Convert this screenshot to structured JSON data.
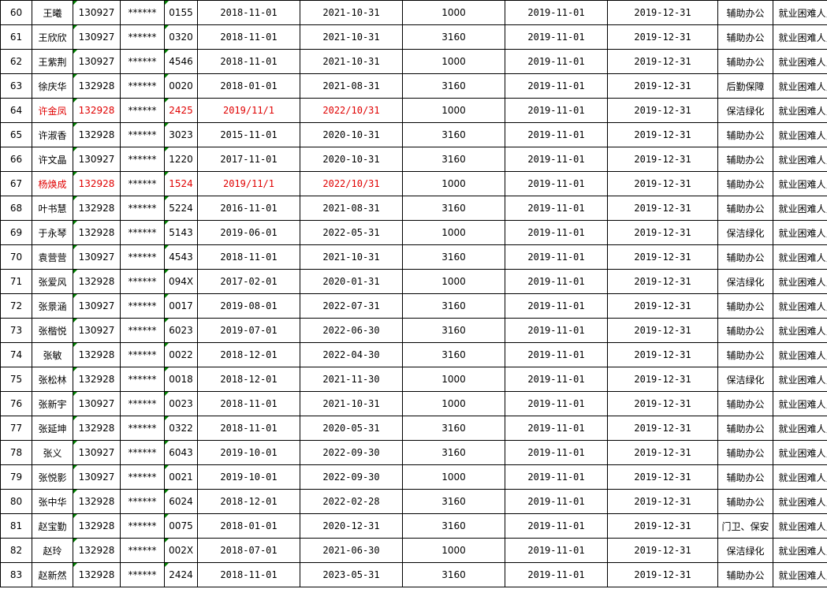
{
  "sheet": {
    "rows": [
      {
        "no": "60",
        "name": "王曦",
        "id_prefix": "130927",
        "mask": "******",
        "id_suffix": "0155",
        "start": "2018-11-01",
        "end": "2021-10-31",
        "amount": "1000",
        "period_start": "2019-11-01",
        "period_end": "2019-12-31",
        "post": "辅助办公",
        "category": "就业困难人员",
        "highlight": false
      },
      {
        "no": "61",
        "name": "王欣欣",
        "id_prefix": "130927",
        "mask": "******",
        "id_suffix": "0320",
        "start": "2018-11-01",
        "end": "2021-10-31",
        "amount": "3160",
        "period_start": "2019-11-01",
        "period_end": "2019-12-31",
        "post": "辅助办公",
        "category": "就业困难人员",
        "highlight": false
      },
      {
        "no": "62",
        "name": "王紫荆",
        "id_prefix": "130927",
        "mask": "******",
        "id_suffix": "4546",
        "start": "2018-11-01",
        "end": "2021-10-31",
        "amount": "1000",
        "period_start": "2019-11-01",
        "period_end": "2019-12-31",
        "post": "辅助办公",
        "category": "就业困难人员",
        "highlight": false
      },
      {
        "no": "63",
        "name": "徐庆华",
        "id_prefix": "132928",
        "mask": "******",
        "id_suffix": "0020",
        "start": "2018-01-01",
        "end": "2021-08-31",
        "amount": "3160",
        "period_start": "2019-11-01",
        "period_end": "2019-12-31",
        "post": "后勤保障",
        "category": "就业困难人员",
        "highlight": false
      },
      {
        "no": "64",
        "name": "许金凤",
        "id_prefix": "132928",
        "mask": "******",
        "id_suffix": "2425",
        "start": "2019/11/1",
        "end": "2022/10/31",
        "amount": "1000",
        "period_start": "2019-11-01",
        "period_end": "2019-12-31",
        "post": "保洁绿化",
        "category": "就业困难人员",
        "highlight": true
      },
      {
        "no": "65",
        "name": "许淑香",
        "id_prefix": "132928",
        "mask": "******",
        "id_suffix": "3023",
        "start": "2015-11-01",
        "end": "2020-10-31",
        "amount": "3160",
        "period_start": "2019-11-01",
        "period_end": "2019-12-31",
        "post": "辅助办公",
        "category": "就业困难人员",
        "highlight": false
      },
      {
        "no": "66",
        "name": "许文晶",
        "id_prefix": "130927",
        "mask": "******",
        "id_suffix": "1220",
        "start": "2017-11-01",
        "end": "2020-10-31",
        "amount": "3160",
        "period_start": "2019-11-01",
        "period_end": "2019-12-31",
        "post": "辅助办公",
        "category": "就业困难人员",
        "highlight": false
      },
      {
        "no": "67",
        "name": "杨焕成",
        "id_prefix": "132928",
        "mask": "******",
        "id_suffix": "1524",
        "start": "2019/11/1",
        "end": "2022/10/31",
        "amount": "1000",
        "period_start": "2019-11-01",
        "period_end": "2019-12-31",
        "post": "辅助办公",
        "category": "就业困难人员",
        "highlight": true
      },
      {
        "no": "68",
        "name": "叶书慧",
        "id_prefix": "132928",
        "mask": "******",
        "id_suffix": "5224",
        "start": "2016-11-01",
        "end": "2021-08-31",
        "amount": "3160",
        "period_start": "2019-11-01",
        "period_end": "2019-12-31",
        "post": "辅助办公",
        "category": "就业困难人员",
        "highlight": false
      },
      {
        "no": "69",
        "name": "于永琴",
        "id_prefix": "132928",
        "mask": "******",
        "id_suffix": "5143",
        "start": "2019-06-01",
        "end": "2022-05-31",
        "amount": "1000",
        "period_start": "2019-11-01",
        "period_end": "2019-12-31",
        "post": "保洁绿化",
        "category": "就业困难人员",
        "highlight": false
      },
      {
        "no": "70",
        "name": "袁营营",
        "id_prefix": "130927",
        "mask": "******",
        "id_suffix": "4543",
        "start": "2018-11-01",
        "end": "2021-10-31",
        "amount": "3160",
        "period_start": "2019-11-01",
        "period_end": "2019-12-31",
        "post": "辅助办公",
        "category": "就业困难人员",
        "highlight": false
      },
      {
        "no": "71",
        "name": "张爱风",
        "id_prefix": "132928",
        "mask": "******",
        "id_suffix": "094X",
        "start": "2017-02-01",
        "end": "2020-01-31",
        "amount": "1000",
        "period_start": "2019-11-01",
        "period_end": "2019-12-31",
        "post": "保洁绿化",
        "category": "就业困难人员",
        "highlight": false
      },
      {
        "no": "72",
        "name": "张景涵",
        "id_prefix": "130927",
        "mask": "******",
        "id_suffix": "0017",
        "start": "2019-08-01",
        "end": "2022-07-31",
        "amount": "3160",
        "period_start": "2019-11-01",
        "period_end": "2019-12-31",
        "post": "辅助办公",
        "category": "就业困难人员",
        "highlight": false
      },
      {
        "no": "73",
        "name": "张楷悦",
        "id_prefix": "130927",
        "mask": "******",
        "id_suffix": "6023",
        "start": "2019-07-01",
        "end": "2022-06-30",
        "amount": "3160",
        "period_start": "2019-11-01",
        "period_end": "2019-12-31",
        "post": "辅助办公",
        "category": "就业困难人员",
        "highlight": false
      },
      {
        "no": "74",
        "name": "张敏",
        "id_prefix": "132928",
        "mask": "******",
        "id_suffix": "0022",
        "start": "2018-12-01",
        "end": "2022-04-30",
        "amount": "3160",
        "period_start": "2019-11-01",
        "period_end": "2019-12-31",
        "post": "辅助办公",
        "category": "就业困难人员",
        "highlight": false
      },
      {
        "no": "75",
        "name": "张松林",
        "id_prefix": "132928",
        "mask": "******",
        "id_suffix": "0018",
        "start": "2018-12-01",
        "end": "2021-11-30",
        "amount": "1000",
        "period_start": "2019-11-01",
        "period_end": "2019-12-31",
        "post": "保洁绿化",
        "category": "就业困难人员",
        "highlight": false
      },
      {
        "no": "76",
        "name": "张新宇",
        "id_prefix": "130927",
        "mask": "******",
        "id_suffix": "0023",
        "start": "2018-11-01",
        "end": "2021-10-31",
        "amount": "1000",
        "period_start": "2019-11-01",
        "period_end": "2019-12-31",
        "post": "辅助办公",
        "category": "就业困难人员",
        "highlight": false
      },
      {
        "no": "77",
        "name": "张延坤",
        "id_prefix": "132928",
        "mask": "******",
        "id_suffix": "0322",
        "start": "2018-11-01",
        "end": "2020-05-31",
        "amount": "3160",
        "period_start": "2019-11-01",
        "period_end": "2019-12-31",
        "post": "辅助办公",
        "category": "就业困难人员",
        "highlight": false
      },
      {
        "no": "78",
        "name": "张义",
        "id_prefix": "130927",
        "mask": "******",
        "id_suffix": "6043",
        "start": "2019-10-01",
        "end": "2022-09-30",
        "amount": "3160",
        "period_start": "2019-11-01",
        "period_end": "2019-12-31",
        "post": "辅助办公",
        "category": "就业困难人员",
        "highlight": false
      },
      {
        "no": "79",
        "name": "张悦影",
        "id_prefix": "130927",
        "mask": "******",
        "id_suffix": "0021",
        "start": "2019-10-01",
        "end": "2022-09-30",
        "amount": "1000",
        "period_start": "2019-11-01",
        "period_end": "2019-12-31",
        "post": "辅助办公",
        "category": "就业困难人员",
        "highlight": false
      },
      {
        "no": "80",
        "name": "张中华",
        "id_prefix": "132928",
        "mask": "******",
        "id_suffix": "6024",
        "start": "2018-12-01",
        "end": "2022-02-28",
        "amount": "3160",
        "period_start": "2019-11-01",
        "period_end": "2019-12-31",
        "post": "辅助办公",
        "category": "就业困难人员",
        "highlight": false
      },
      {
        "no": "81",
        "name": "赵宝勤",
        "id_prefix": "132928",
        "mask": "******",
        "id_suffix": "0075",
        "start": "2018-01-01",
        "end": "2020-12-31",
        "amount": "3160",
        "period_start": "2019-11-01",
        "period_end": "2019-12-31",
        "post": "门卫、保安",
        "category": "就业困难人员",
        "highlight": false
      },
      {
        "no": "82",
        "name": "赵玲",
        "id_prefix": "132928",
        "mask": "******",
        "id_suffix": "002X",
        "start": "2018-07-01",
        "end": "2021-06-30",
        "amount": "1000",
        "period_start": "2019-11-01",
        "period_end": "2019-12-31",
        "post": "保洁绿化",
        "category": "就业困难人员",
        "highlight": false
      },
      {
        "no": "83",
        "name": "赵新然",
        "id_prefix": "132928",
        "mask": "******",
        "id_suffix": "2424",
        "start": "2018-11-01",
        "end": "2023-05-31",
        "amount": "3160",
        "period_start": "2019-11-01",
        "period_end": "2019-12-31",
        "post": "辅助办公",
        "category": "就业困难人员",
        "highlight": false
      }
    ],
    "highlight_color": "#e00000",
    "flag_color": "#008000"
  }
}
